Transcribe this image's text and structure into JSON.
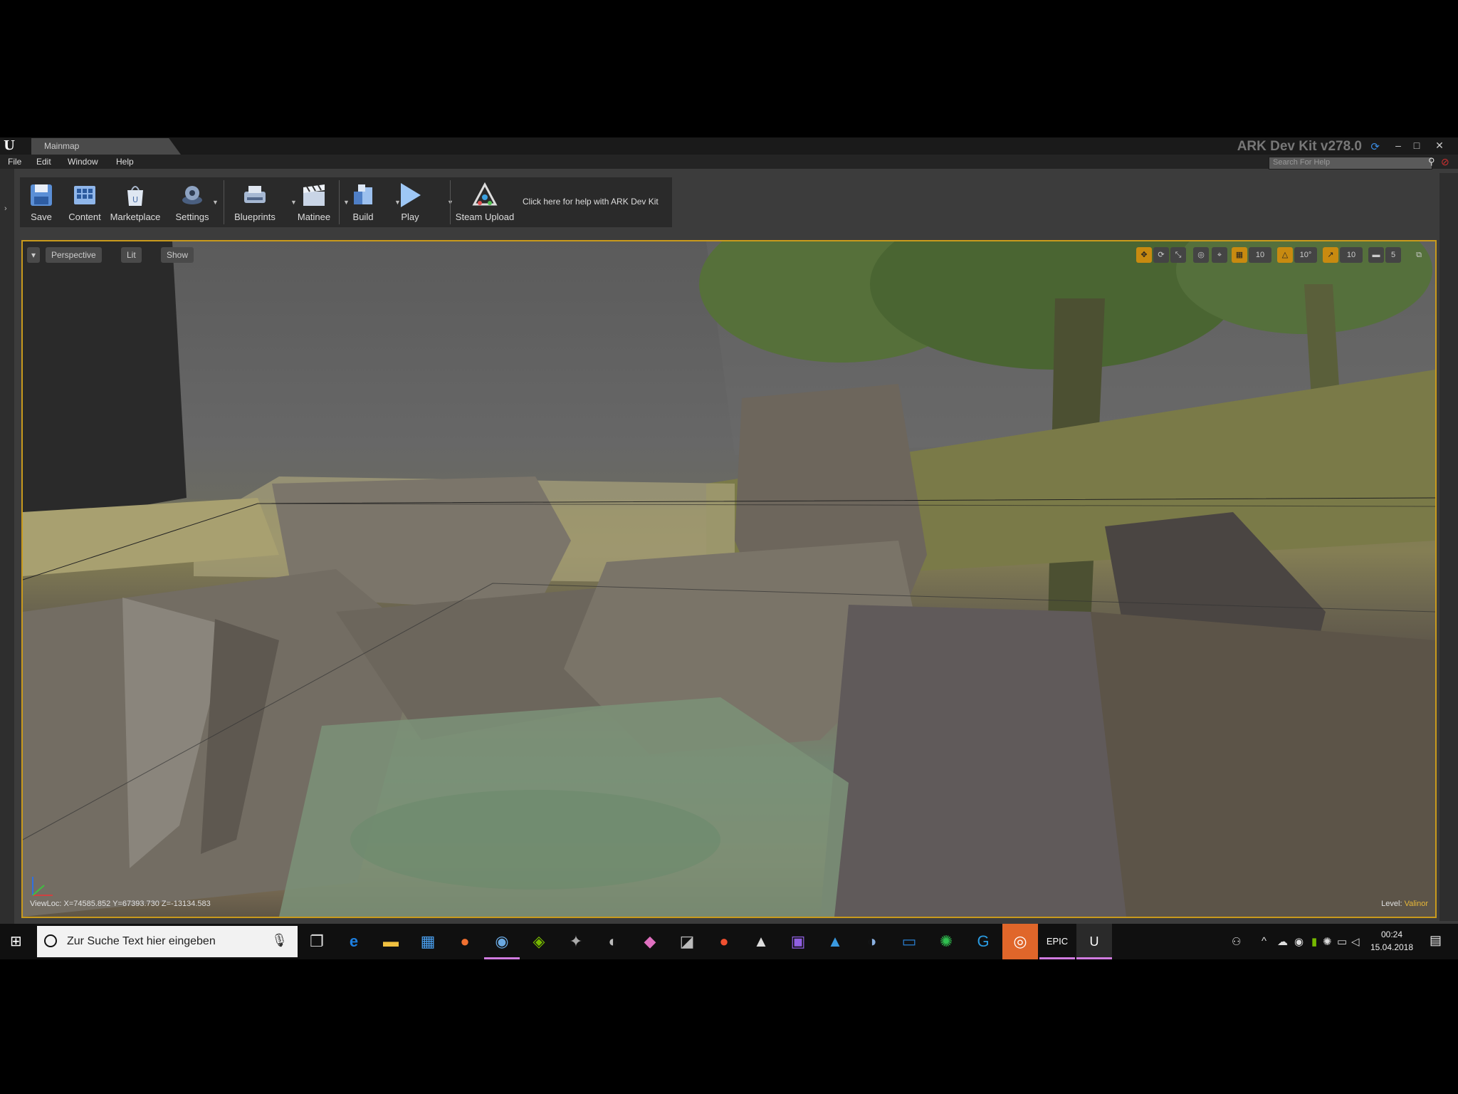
{
  "window": {
    "tab_title": "Mainmap",
    "app_title": "ARK Dev Kit v278.0",
    "controls": {
      "minimize": "–",
      "maximize": "□",
      "close": "✕"
    }
  },
  "menu": [
    "File",
    "Edit",
    "Window",
    "Help"
  ],
  "search": {
    "placeholder": "Search For Help"
  },
  "toolbar": {
    "buttons": [
      {
        "label": "Save",
        "icon": "save-icon"
      },
      {
        "label": "Content",
        "icon": "content-icon"
      },
      {
        "label": "Marketplace",
        "icon": "marketplace-icon"
      },
      {
        "label": "Settings",
        "icon": "settings-icon"
      },
      {
        "label": "Blueprints",
        "icon": "blueprints-icon"
      },
      {
        "label": "Matinee",
        "icon": "matinee-icon"
      },
      {
        "label": "Build",
        "icon": "build-icon"
      },
      {
        "label": "Play",
        "icon": "play-icon"
      },
      {
        "label": "Steam Upload",
        "icon": "steam-upload-icon"
      }
    ],
    "help_text": "Click here for help with ARK Dev Kit"
  },
  "viewport": {
    "perspective": "Perspective",
    "lit": "Lit",
    "show": "Show",
    "grid_snap": "10",
    "rotation_snap": "10°",
    "scale_snap": "10",
    "camera_speed": "5",
    "viewloc": "ViewLoc: X=74585.852 Y=67393.730 Z=-13134.583",
    "level_label": "Level:",
    "level_name": "Valinor"
  },
  "taskbar": {
    "search_placeholder": "Zur Suche Text hier eingeben",
    "time": "00:24",
    "date": "15.04.2018"
  },
  "colors": {
    "viewport_border": "#c99a1c",
    "accent_orange": "#c88a10",
    "taskbar_active": "#d07be0"
  }
}
